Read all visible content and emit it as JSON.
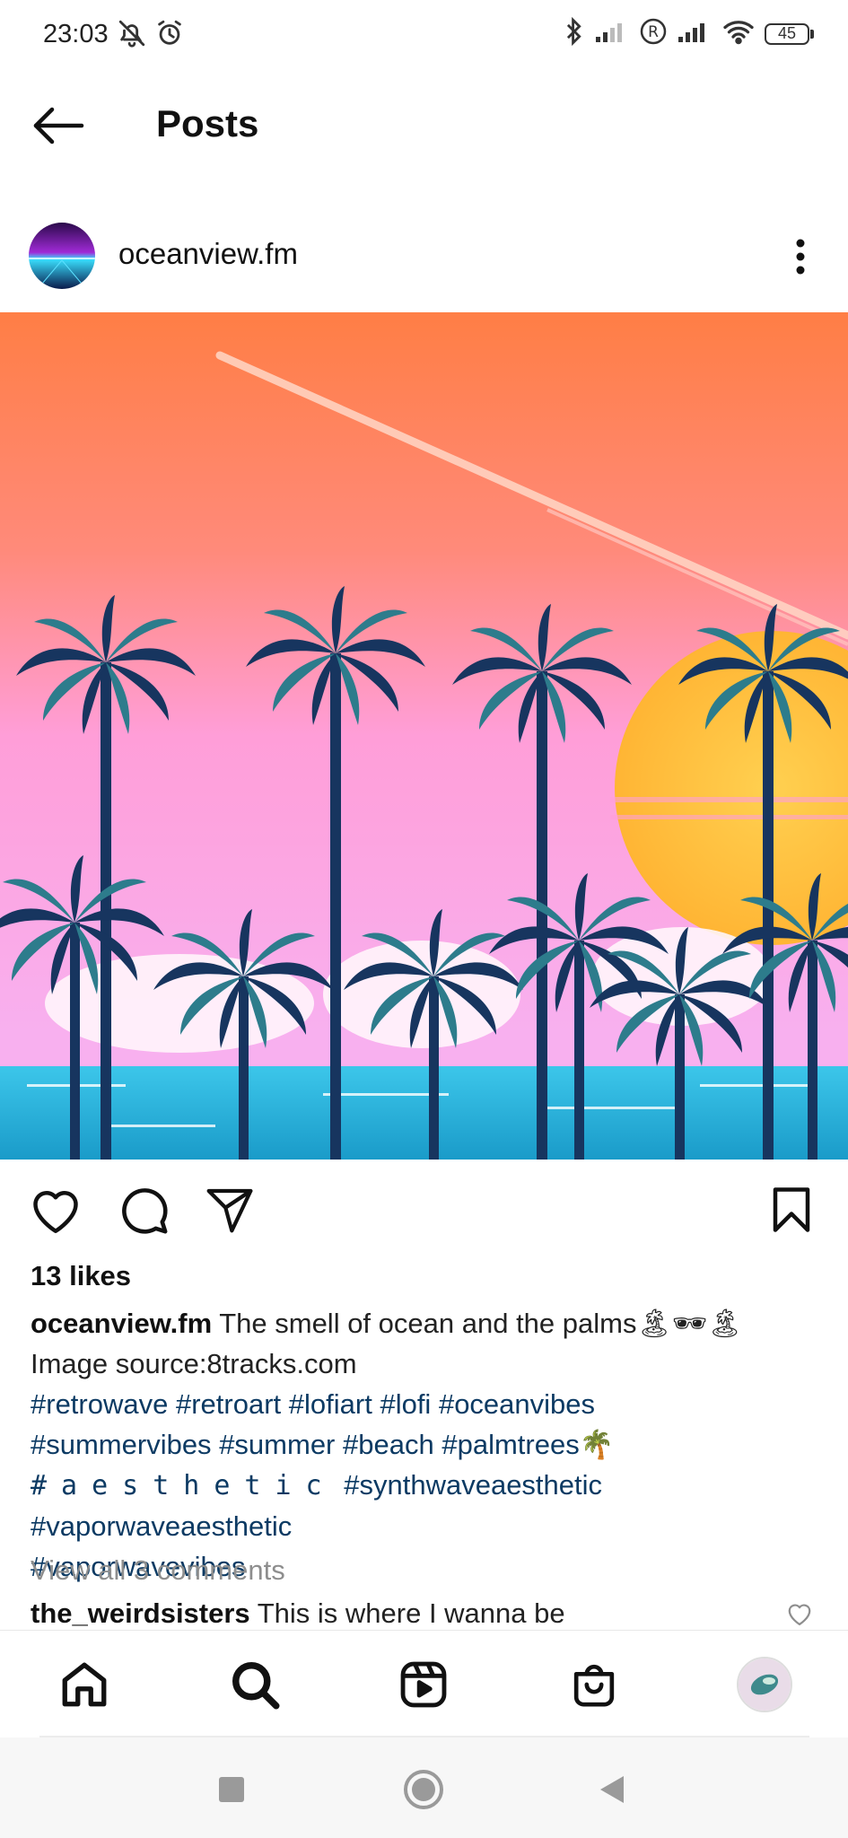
{
  "status_bar": {
    "time": "23:03",
    "battery": "45",
    "icons": [
      "bell-off-icon",
      "alarm-icon",
      "bluetooth-icon",
      "signal-icon",
      "roaming-icon",
      "signal-icon",
      "wifi-icon",
      "battery-icon"
    ]
  },
  "header": {
    "title": "Posts",
    "back_icon": "arrow-left-icon"
  },
  "post": {
    "username": "oceanview.fm",
    "likes": "13 likes",
    "caption": {
      "username": "oceanview.fm",
      "text": " The smell of ocean and the palms🏝🕶🏝",
      "source": "Image source:8tracks.com",
      "tags": [
        "#retrowave",
        "#retroart",
        "#lofiart",
        "#lofi",
        "#oceanvibes",
        "#summervibes",
        "#summer",
        "#beach",
        "#palmtrees🌴"
      ],
      "aesthetic": "#aesthetic",
      "tags2": [
        "#synthwaveaesthetic",
        "#vaporwaveaesthetic",
        "#vaporwavevibes"
      ]
    },
    "view_comments": "View all 3 comments",
    "comment": {
      "user": "the_weirdsisters",
      "text": " This is where I wanna be"
    }
  },
  "colors": {
    "sky_top": "#ff7e45",
    "sky_pink": "#ff9ee0",
    "sea": "#2fb5dc",
    "sun": "#ffc03a",
    "palm": "#17355f",
    "hashtag": "#0c3a63"
  }
}
